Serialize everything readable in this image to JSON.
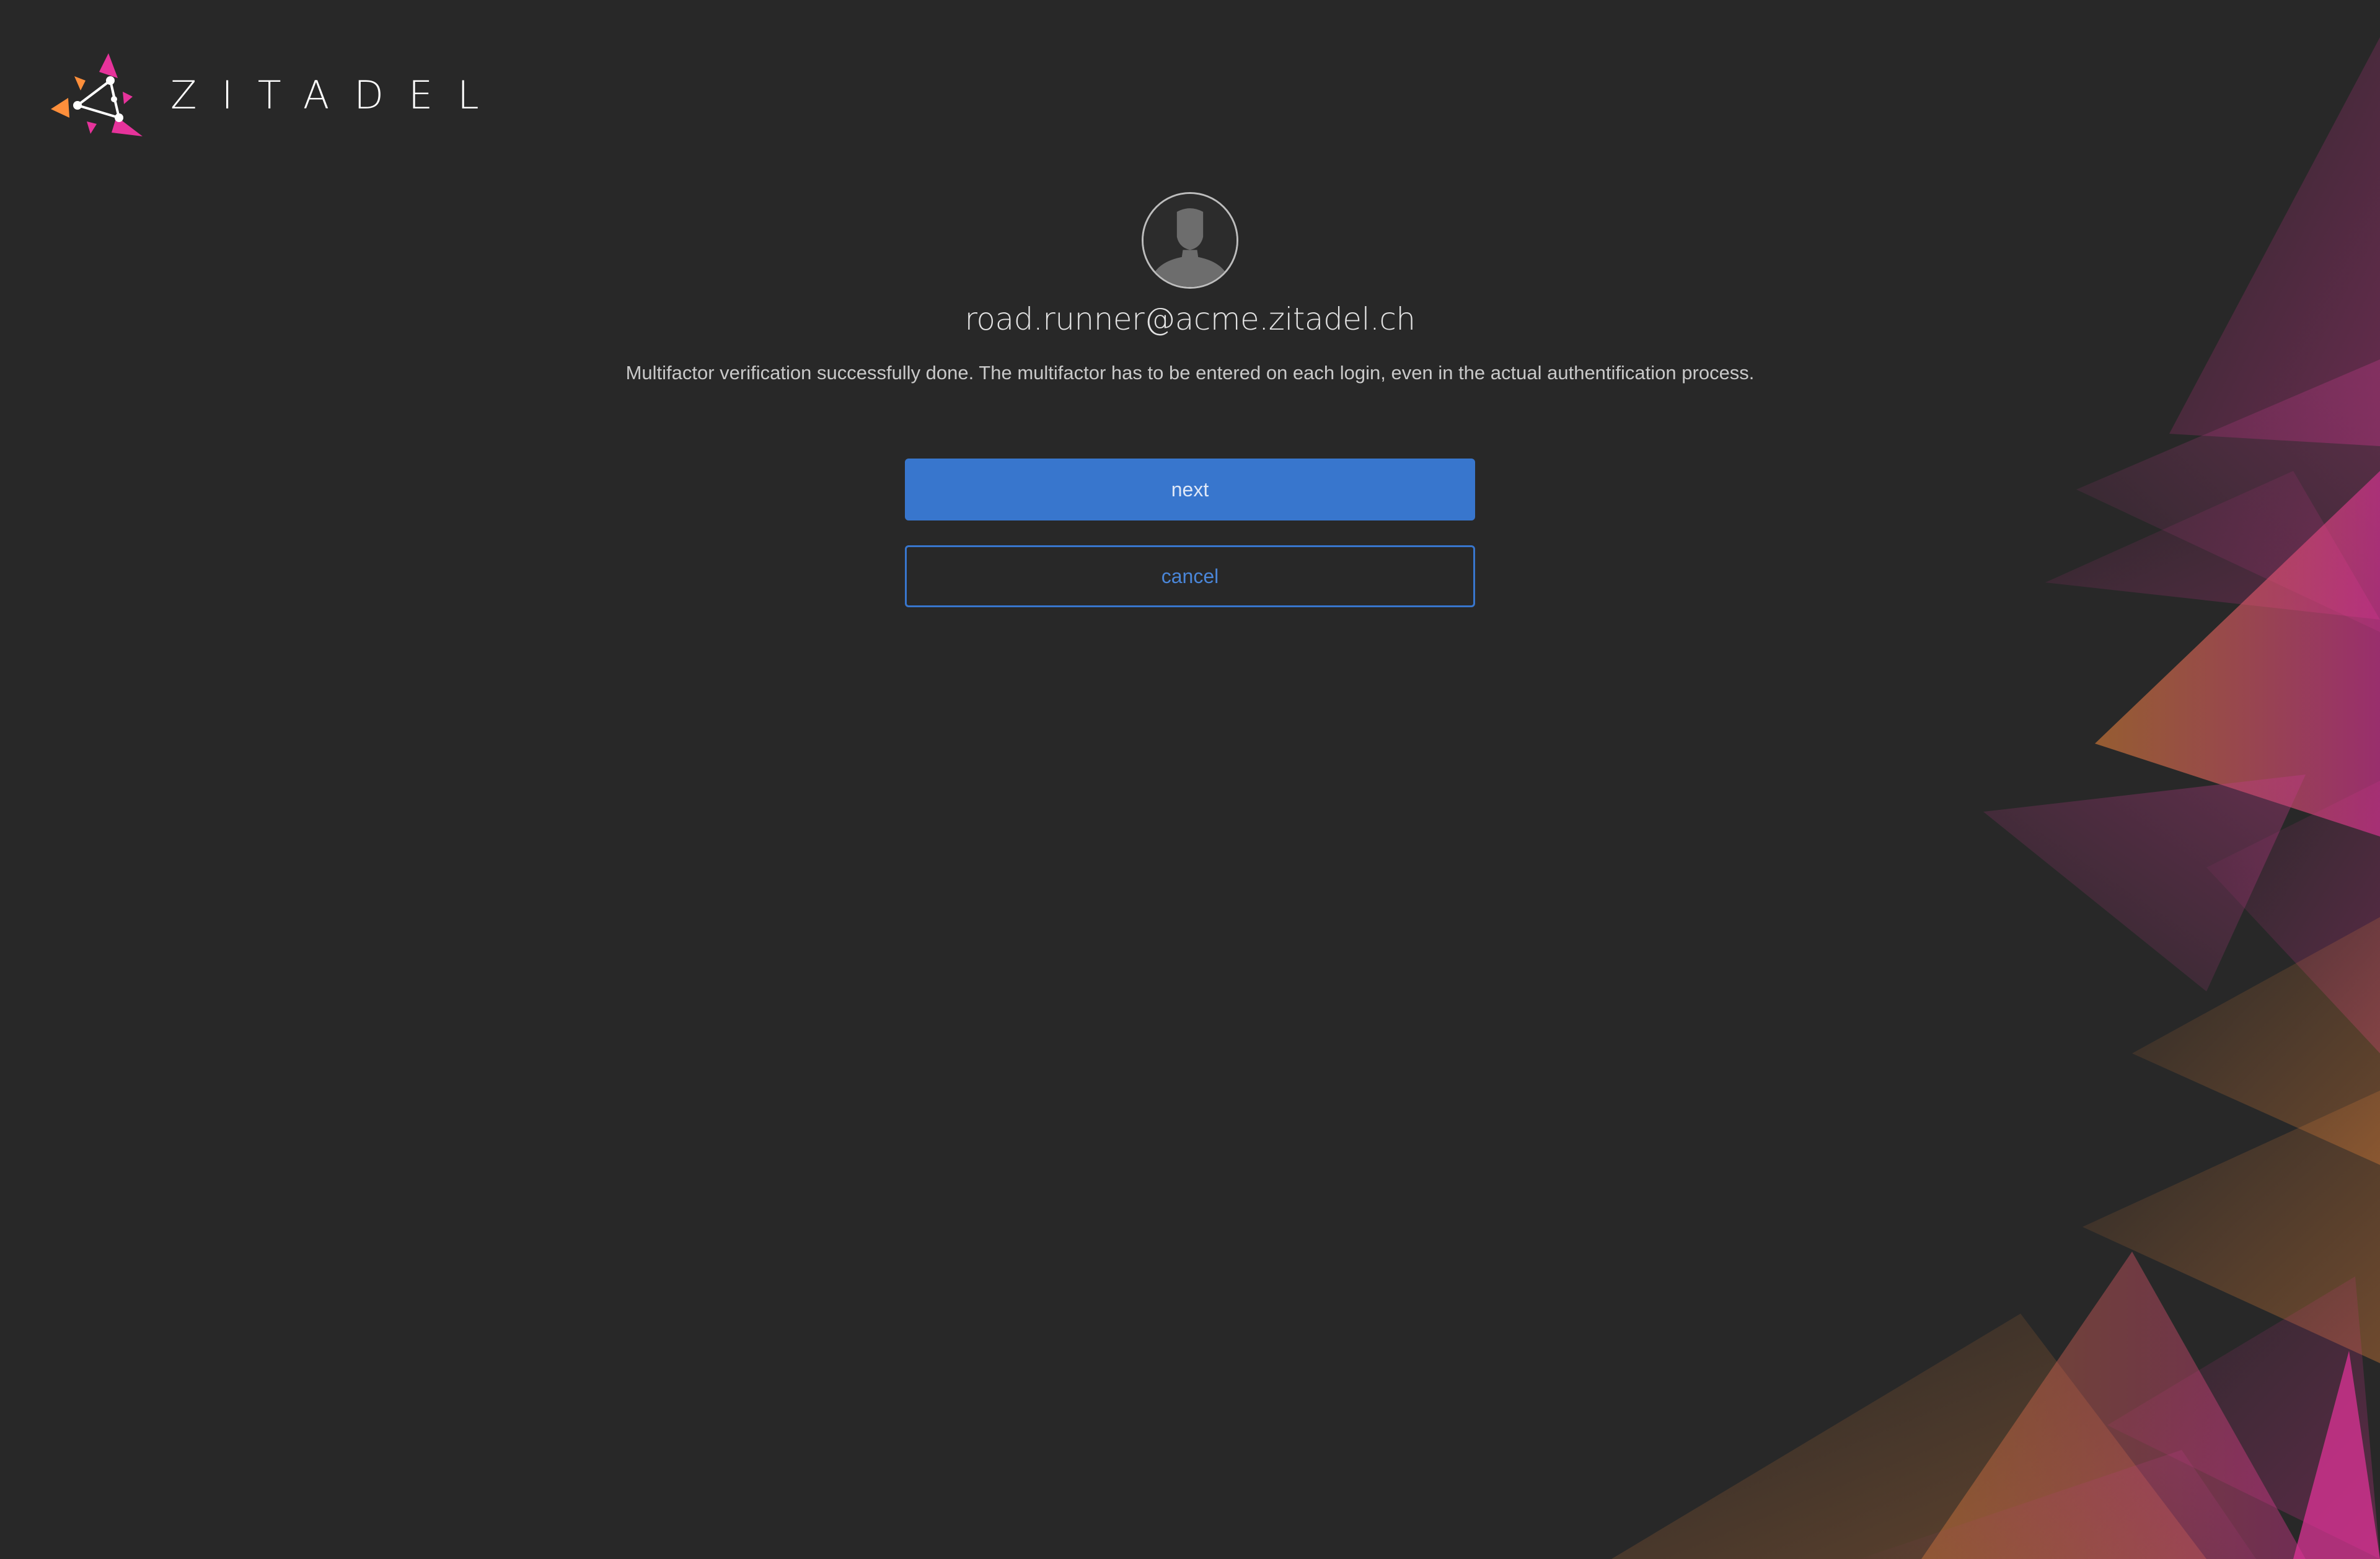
{
  "brand": {
    "name": "ZITADEL",
    "logo_icon": "zitadel-triangle-logo",
    "colors": {
      "pink": "#e6339b",
      "orange": "#ff8f3b",
      "white": "#ffffff"
    }
  },
  "user": {
    "avatar_icon": "user-silhouette-icon",
    "login_name": "road.runner@acme.zitadel.ch"
  },
  "message": "Multifactor verification successfully done. The multifactor has to be entered on each login, even in the actual authentification process.",
  "actions": {
    "next_label": "next",
    "cancel_label": "cancel"
  },
  "theme": {
    "background": "#282828",
    "primary": "#3876cd",
    "text": "#e2e2e2"
  }
}
